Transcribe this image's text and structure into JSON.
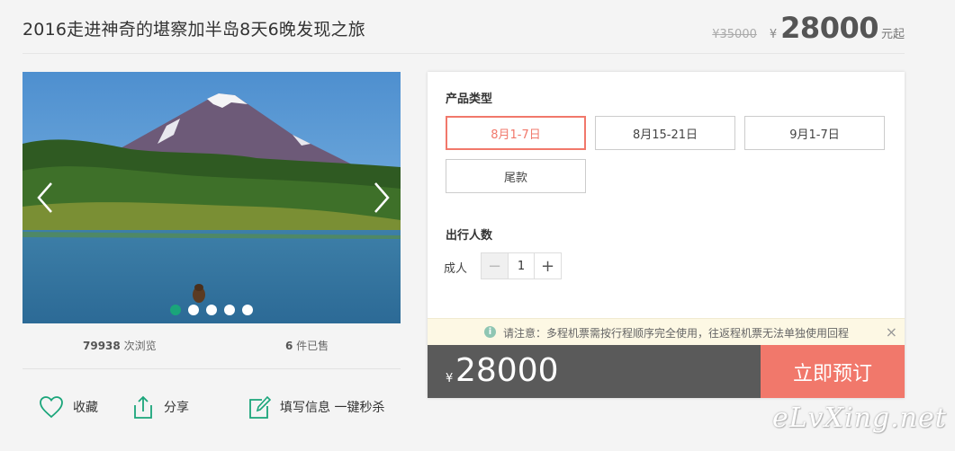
{
  "product": {
    "title": "2016走进神奇的堪察加半岛8天6晚发现之旅",
    "original_price": "¥35000",
    "currency_symbol": "¥",
    "price": "28000",
    "price_unit": "元起"
  },
  "stats": {
    "views_count": "79938",
    "views_label": " 次浏览",
    "sold_count": "6",
    "sold_label": " 件已售"
  },
  "actions": {
    "favorite_label": "收藏",
    "share_label": "分享",
    "seckill_label": "填写信息 一键秒杀"
  },
  "booking": {
    "product_type_label": "产品类型",
    "options": [
      "8月1-7日",
      "8月15-21日",
      "9月1-7日",
      "尾款"
    ],
    "selected_option": "8月1-7日",
    "travelers_label": "出行人数",
    "adult_label": "成人",
    "quantity": "1",
    "minus_symbol": "−",
    "plus_symbol": "+",
    "notice_icon": "i",
    "notice": "请注意：多程机票需按行程顺序完全使用，往返程机票无法单独使用回程",
    "close_symbol": "×",
    "total_symbol": "¥",
    "total_price": "28000",
    "book_button": "立即预订"
  },
  "gallery": {
    "slide_count": 5,
    "active_slide": 1
  },
  "watermark": "eLvXing.net",
  "colors": {
    "accent": "#f1786b",
    "green": "#1aa57a",
    "price_bar": "#5a5a5a"
  }
}
